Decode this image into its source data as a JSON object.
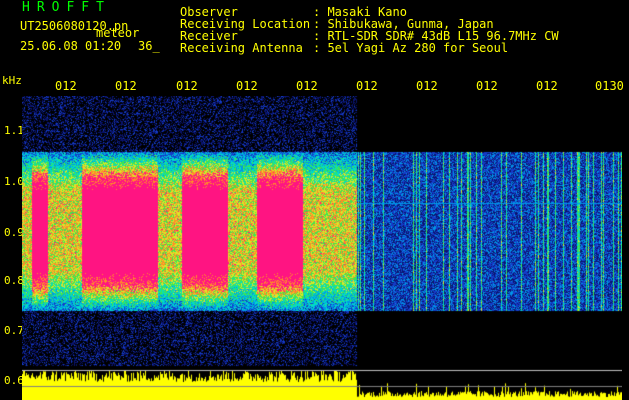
{
  "header": {
    "app_title": "HROFFT",
    "file_name": "UT2506080120.pn",
    "file_ext": "meteor",
    "date_time": "25.06.08 01:20",
    "count": "36_"
  },
  "info": [
    {
      "label": "Observer",
      "value": ": Masaki Kano"
    },
    {
      "label": "Receiving Location",
      "value": ": Shibukawa, Gunma, Japan"
    },
    {
      "label": "Receiver",
      "value": ": RTL-SDR SDR# 43dB L15 96.7MHz CW"
    },
    {
      "label": "Receiving Antenna",
      "value": ": 5el Yagi Az 280 for Seoul"
    }
  ],
  "axis": {
    "unit_label": "kHz",
    "y_ticks": [
      "1.1",
      "1.0",
      "0.9",
      "0.8",
      "0.7",
      "0.6"
    ],
    "x_ticks": [
      "012",
      "012",
      "012",
      "012",
      "012",
      "012",
      "012",
      "012",
      "012",
      "0130"
    ]
  },
  "colors": {
    "label_yellow": "#ffff00",
    "title_green": "#00ff00",
    "background": "#000000",
    "signal_pink": "#ff1080",
    "noise_blue": "#1030c0"
  }
}
